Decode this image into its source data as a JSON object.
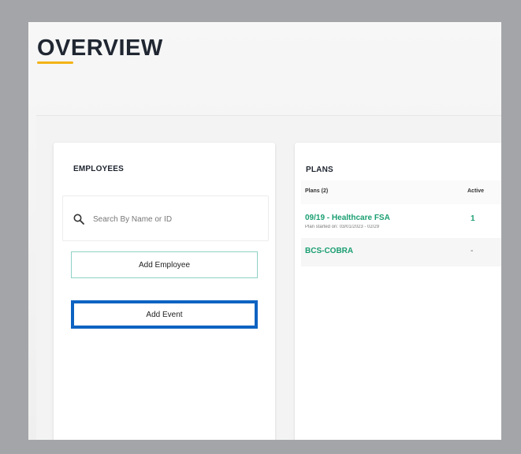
{
  "header": {
    "title": "OVERVIEW"
  },
  "employees": {
    "title": "EMPLOYEES",
    "search_placeholder": "Search By Name or ID",
    "add_employee_label": "Add Employee",
    "add_event_label": "Add Event"
  },
  "plans": {
    "title": "PLANS",
    "columns": {
      "plans": "Plans (2)",
      "active": "Active"
    },
    "rows": [
      {
        "name": "09/19 - Healthcare FSA",
        "subtitle": "Plan started on: 03/01/2023 - 02/29",
        "active": "1"
      },
      {
        "name": "BCS-COBRA",
        "subtitle": "",
        "active": "-"
      }
    ]
  },
  "colors": {
    "accent": "#f2b316",
    "plan_green": "#1a9e72",
    "focus_blue": "#0d63c2",
    "button_border": "#8fd1c5"
  }
}
